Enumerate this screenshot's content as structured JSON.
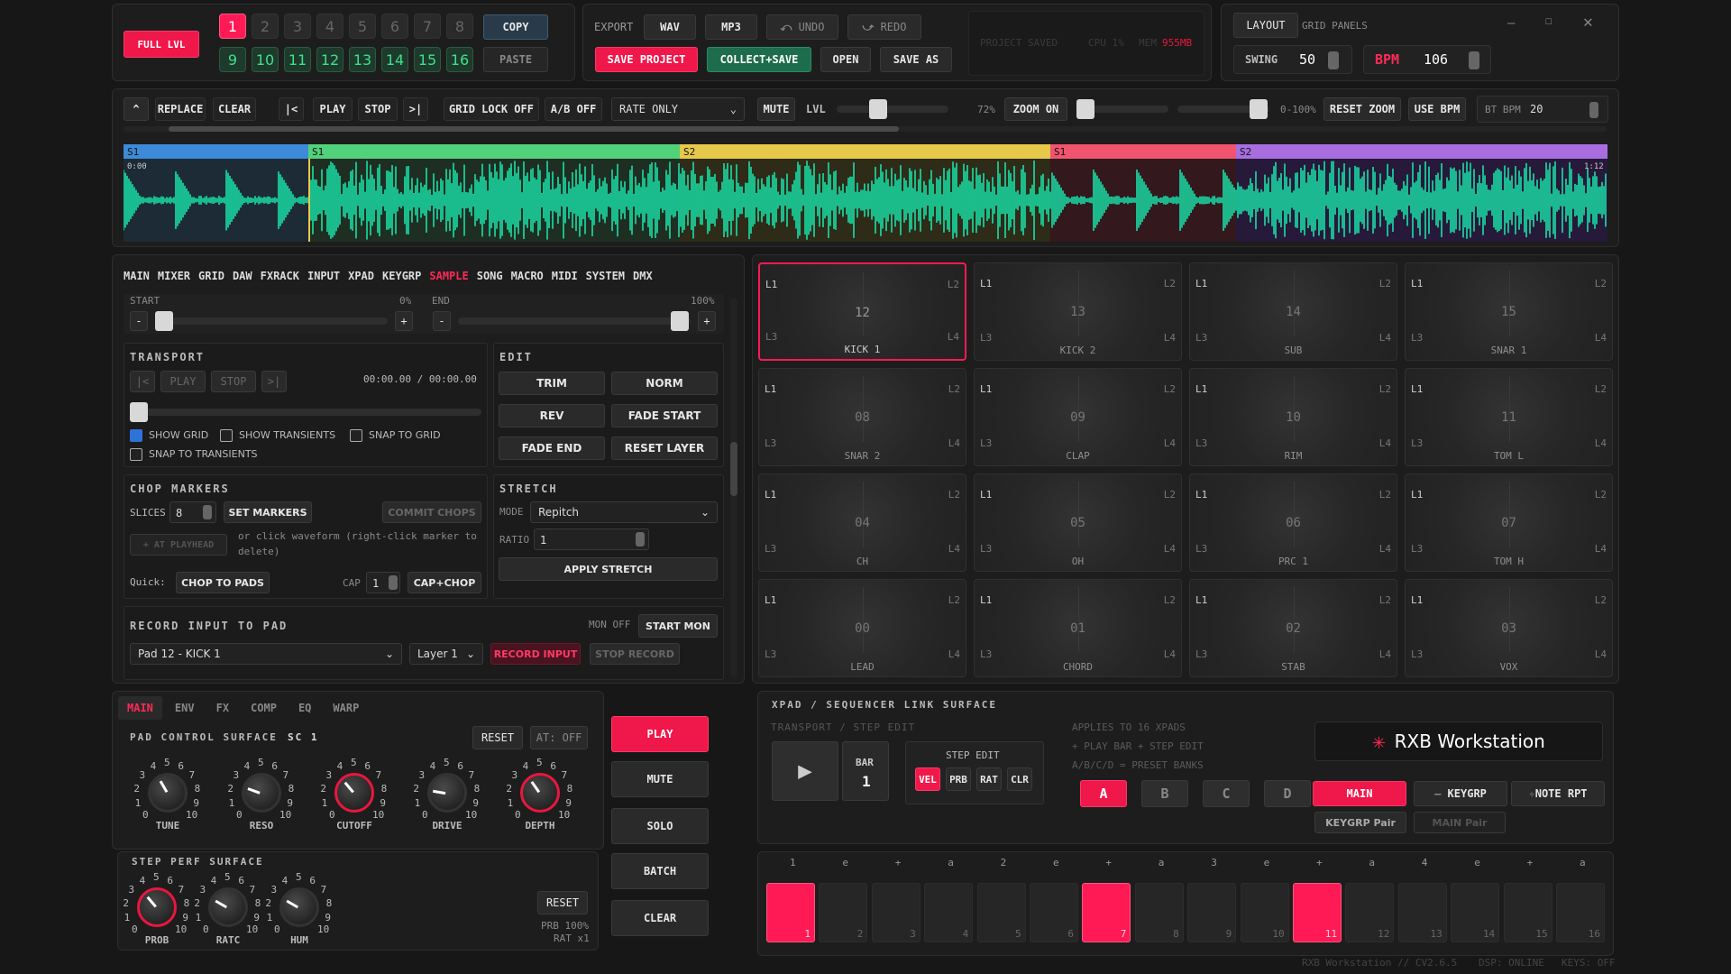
{
  "header": {
    "full_lvl": "FULL LVL",
    "bank_nums_top": [
      "1",
      "2",
      "3",
      "4",
      "5",
      "6",
      "7",
      "8"
    ],
    "bank_nums_bottom": [
      "9",
      "10",
      "11",
      "12",
      "13",
      "14",
      "15",
      "16"
    ],
    "copy": "COPY",
    "paste": "PASTE",
    "export": "EXPORT",
    "wav": "WAV",
    "mp3": "MP3",
    "undo": "UNDO",
    "redo": "REDO",
    "save_project": "SAVE PROJECT",
    "collect_save": "COLLECT+SAVE",
    "open": "OPEN",
    "save_as": "SAVE AS",
    "status": {
      "saved": "PROJECT SAVED",
      "cpu": "CPU 1%",
      "mem_label": "MEM",
      "mem_value": "955MB"
    },
    "layout": "LAYOUT",
    "grid_panels": "GRID PANELS",
    "swing_label": "SWING",
    "swing_value": "50",
    "bpm_label": "BPM",
    "bpm_value": "106"
  },
  "toolbar": {
    "replace": "REPLACE",
    "clear": "CLEAR",
    "to_start": "|<",
    "play": "PLAY",
    "stop": "STOP",
    "to_end": ">|",
    "grid_lock": "GRID LOCK OFF",
    "ab": "A/B OFF",
    "rate_select": "RATE ONLY",
    "mute": "MUTE",
    "lvl": "LVL",
    "lvl_pct": "72%",
    "zoom_on": "ZOOM ON",
    "zoom_range": "0-100%",
    "reset_zoom": "RESET ZOOM",
    "use_bpm": "USE BPM",
    "bt_bpm_label": "BT BPM",
    "bt_bpm_value": "20"
  },
  "waveform": {
    "segments": [
      {
        "label": "S1",
        "color": "#3d8bd8"
      },
      {
        "label": "S1",
        "color": "#52d17b"
      },
      {
        "label": "S2",
        "color": "#e6c94a"
      },
      {
        "label": "S1",
        "color": "#f0546e"
      },
      {
        "label": "S2",
        "color": "#a86ee0"
      }
    ],
    "time_start": "0:00",
    "time_end": "1:12"
  },
  "nav": {
    "tabs": [
      "MAIN",
      "MIXER",
      "GRID",
      "DAW",
      "FXRACK",
      "INPUT",
      "XPAD",
      "KEYGRP",
      "SAMPLE",
      "SONG",
      "MACRO",
      "MIDI",
      "SYSTEM",
      "DMX"
    ],
    "active": "SAMPLE"
  },
  "sample": {
    "start_label": "START",
    "start_pct": "0%",
    "end_label": "END",
    "end_pct": "100%",
    "minus": "-",
    "plus": "+",
    "transport": {
      "title": "TRANSPORT",
      "to_start": "|<",
      "play": "PLAY",
      "stop": "STOP",
      "to_end": ">|",
      "time": "00:00.00 / 00:00.00",
      "show_grid": "SHOW GRID",
      "show_transients": "SHOW TRANSIENTS",
      "snap_grid": "SNAP TO GRID",
      "snap_transients": "SNAP TO TRANSIENTS"
    },
    "edit": {
      "title": "EDIT",
      "trim": "TRIM",
      "norm": "NORM",
      "rev": "REV",
      "fade_start": "FADE START",
      "fade_end": "FADE END",
      "reset_layer": "RESET LAYER"
    },
    "chop": {
      "title": "CHOP MARKERS",
      "slices_label": "SLICES",
      "slices_value": "8",
      "set_markers": "SET MARKERS",
      "commit": "COMMIT CHOPS",
      "at_playhead": "+ AT PLAYHEAD",
      "hint": "or click waveform (right-click marker to delete)",
      "quick": "Quick:",
      "chop_pads": "CHOP TO PADS",
      "cap": "CAP",
      "cap_value": "1",
      "cap_chop": "CAP+CHOP"
    },
    "stretch": {
      "title": "STRETCH",
      "mode_label": "MODE",
      "mode_value": "Repitch",
      "ratio_label": "RATIO",
      "ratio_value": "1",
      "apply": "APPLY STRETCH"
    },
    "record": {
      "title": "RECORD INPUT TO PAD",
      "mon": "MON OFF",
      "start_mon": "START MON",
      "pad": "Pad 12 - KICK 1",
      "layer": "Layer 1",
      "record": "RECORD INPUT",
      "stop": "STOP RECORD"
    }
  },
  "pads": [
    {
      "num": "12",
      "name": "KICK 1"
    },
    {
      "num": "13",
      "name": "KICK 2"
    },
    {
      "num": "14",
      "name": "SUB"
    },
    {
      "num": "15",
      "name": "SNAR 1"
    },
    {
      "num": "08",
      "name": "SNAR 2"
    },
    {
      "num": "09",
      "name": "CLAP"
    },
    {
      "num": "10",
      "name": "RIM"
    },
    {
      "num": "11",
      "name": "TOM L"
    },
    {
      "num": "04",
      "name": "CH"
    },
    {
      "num": "05",
      "name": "OH"
    },
    {
      "num": "06",
      "name": "PRC 1"
    },
    {
      "num": "07",
      "name": "TOM H"
    },
    {
      "num": "00",
      "name": "LEAD"
    },
    {
      "num": "01",
      "name": "CHORD"
    },
    {
      "num": "02",
      "name": "STAB"
    },
    {
      "num": "03",
      "name": "VOX"
    }
  ],
  "pad_corners": {
    "tl": "L1",
    "tr": "L2",
    "bl": "L3",
    "br": "L4"
  },
  "bottom_tabs": {
    "items": [
      "MAIN",
      "ENV",
      "FX",
      "COMP",
      "EQ",
      "WARP"
    ],
    "active": "MAIN"
  },
  "pad_control": {
    "title": "PAD CONTROL SURFACE",
    "sc": "SC 1",
    "reset": "RESET",
    "at": "AT: OFF",
    "knobs": [
      {
        "name": "TUNE",
        "red": false
      },
      {
        "name": "RESO",
        "red": false
      },
      {
        "name": "CUTOFF",
        "red": true
      },
      {
        "name": "DRIVE",
        "red": false
      },
      {
        "name": "DEPTH",
        "red": true
      }
    ]
  },
  "step_perf": {
    "title": "STEP PERF SURFACE",
    "reset": "RESET",
    "prb": "PRB 100%",
    "rat": "RAT x1",
    "knobs": [
      {
        "name": "PROB",
        "red": true
      },
      {
        "name": "RATC",
        "red": false
      },
      {
        "name": "HUM",
        "red": false
      }
    ]
  },
  "scale_nums": [
    "0",
    "1",
    "2",
    "3",
    "4",
    "5",
    "6",
    "7",
    "8",
    "9",
    "10"
  ],
  "side_buttons": {
    "play": "PLAY",
    "mute": "MUTE",
    "solo": "SOLO",
    "batch": "BATCH",
    "clear": "CLEAR"
  },
  "xpad": {
    "title": "XPAD / SEQUENCER LINK SURFACE",
    "sub": "TRANSPORT / STEP EDIT",
    "bar_label": "BAR",
    "bar_value": "1",
    "step_edit": "STEP EDIT",
    "vel": "VEL",
    "prb": "PRB",
    "rat": "RAT",
    "clr": "CLR",
    "info1": "APPLIES TO 16 XPADS",
    "info2": "+ PLAY BAR + STEP EDIT",
    "info3": "A/B/C/D = PRESET BANKS",
    "banks": [
      "A",
      "B",
      "C",
      "D"
    ],
    "brand": "RXB Workstation",
    "main": "MAIN",
    "keygrp": "KEYGRP",
    "note_rpt": "NOTE RPT",
    "keygrp_pair": "KEYGRP Pair",
    "main_pair": "MAIN Pair"
  },
  "seq": {
    "beat_labels": [
      "1",
      "e",
      "+",
      "a",
      "2",
      "e",
      "+",
      "a",
      "3",
      "e",
      "+",
      "a",
      "4",
      "e",
      "+",
      "a"
    ],
    "step_nums": [
      "1",
      "2",
      "3",
      "4",
      "5",
      "6",
      "7",
      "8",
      "9",
      "10",
      "11",
      "12",
      "13",
      "14",
      "15",
      "16"
    ],
    "active_steps": [
      1,
      7,
      11
    ]
  },
  "footer": {
    "version": "RXB Workstation // CV2.6.5",
    "dsp": "DSP: ONLINE",
    "keys": "KEYS: OFF"
  }
}
